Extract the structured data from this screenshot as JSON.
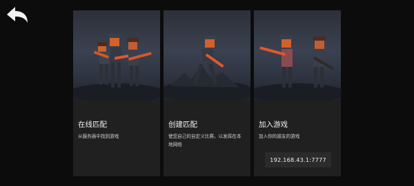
{
  "nav": {
    "back_icon": "back-arrow-icon"
  },
  "cards": [
    {
      "id": "online",
      "title": "在线匹配",
      "description": "从服务器中找到游戏"
    },
    {
      "id": "create",
      "title": "创建匹配",
      "description": "使您自己的自定义比赛，以发挥在本地网络"
    },
    {
      "id": "join",
      "title": "加入游戏",
      "description": "加入你的朋友的游戏",
      "ip_address": "192.168.43.1:7777"
    }
  ],
  "colors": {
    "background": "#0c0c0c",
    "card": "#202020",
    "ip_box": "#2b2b2b",
    "accent_orange": "#e0582c"
  }
}
